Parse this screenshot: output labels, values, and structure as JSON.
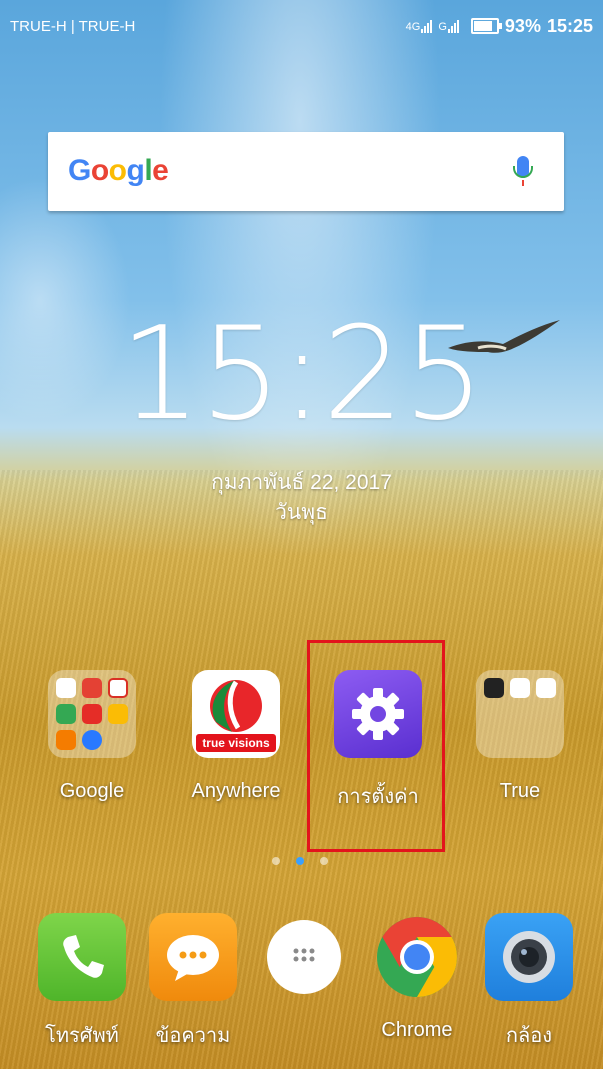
{
  "statusbar": {
    "carrier": "TRUE-H | TRUE-H",
    "network": "4G",
    "battery": "93%",
    "time": "15:25"
  },
  "search": {
    "logo_letters": [
      "G",
      "o",
      "o",
      "g",
      "l",
      "e"
    ],
    "logo_colors": [
      "#4285f4",
      "#ea4335",
      "#fbbc05",
      "#4285f4",
      "#34a853",
      "#ea4335"
    ]
  },
  "clock": {
    "time": "15:25",
    "date": "กุมภาพันธ์ 22, 2017",
    "weekday": "วันพุธ"
  },
  "apps": [
    {
      "label": "Google",
      "icon": "google-folder-icon"
    },
    {
      "label": "Anywhere",
      "icon": "truevisions-anywhere-icon"
    },
    {
      "label": "การตั้งค่า",
      "icon": "settings-gear-icon"
    },
    {
      "label": "True",
      "icon": "true-folder-icon"
    }
  ],
  "truevisions_logo": "true visions",
  "page_indicator": {
    "count": 3,
    "active": 1
  },
  "dock": [
    {
      "label": "โทรศัพท์",
      "icon": "phone-icon",
      "color": "#63c93a"
    },
    {
      "label": "ข้อความ",
      "icon": "messages-icon",
      "color": "#f59c16"
    },
    {
      "label": "",
      "icon": "app-drawer-icon",
      "color": "#ffffff"
    },
    {
      "label": "Chrome",
      "icon": "chrome-icon",
      "color": "#ea4335"
    },
    {
      "label": "กล้อง",
      "icon": "camera-icon",
      "color": "#2a8ee8"
    }
  ],
  "colors": {
    "highlight": "#e3141c",
    "settings": "#6f3fe0"
  }
}
